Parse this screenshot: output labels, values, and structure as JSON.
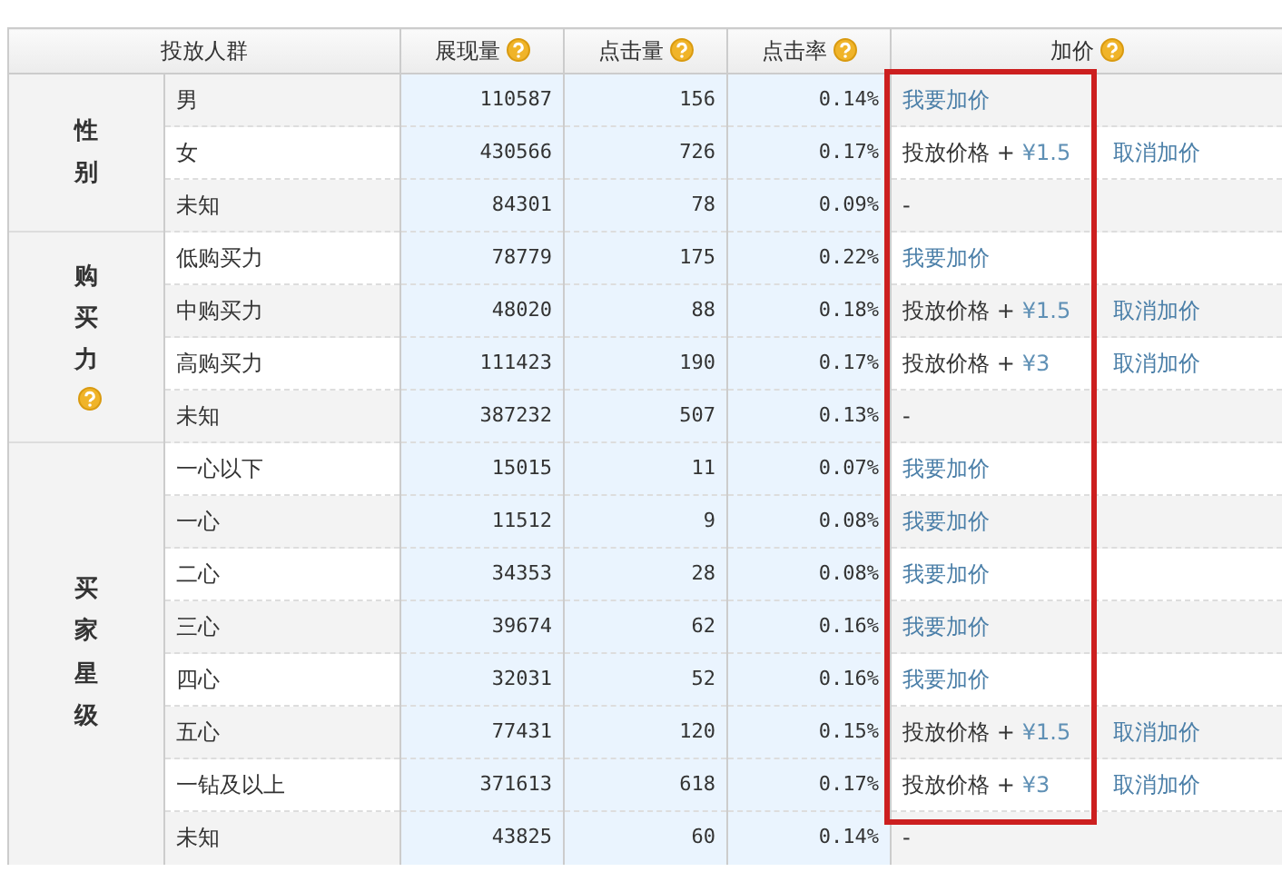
{
  "table": {
    "columns": [
      {
        "label": "投放人群",
        "help": false
      },
      {
        "label": "展现量",
        "help": true
      },
      {
        "label": "点击量",
        "help": true
      },
      {
        "label": "点击率",
        "help": true
      },
      {
        "label": "加价",
        "help": true
      }
    ],
    "groups": [
      {
        "label": "性别",
        "help": false,
        "rows": [
          {
            "name": "男",
            "impressions": "110587",
            "clicks": "156",
            "ctr": "0.14%",
            "bid": {
              "kind": "add",
              "link": "我要加价"
            }
          },
          {
            "name": "女",
            "impressions": "430566",
            "clicks": "726",
            "ctr": "0.17%",
            "bid": {
              "kind": "price",
              "label": "投放价格",
              "op": "+",
              "amount": "¥1.5",
              "cancel": "取消加价"
            }
          },
          {
            "name": "未知",
            "impressions": "84301",
            "clicks": "78",
            "ctr": "0.09%",
            "bid": {
              "kind": "none",
              "text": "-"
            }
          }
        ]
      },
      {
        "label": "购买力",
        "help": true,
        "rows": [
          {
            "name": "低购买力",
            "impressions": "78779",
            "clicks": "175",
            "ctr": "0.22%",
            "bid": {
              "kind": "add",
              "link": "我要加价"
            }
          },
          {
            "name": "中购买力",
            "impressions": "48020",
            "clicks": "88",
            "ctr": "0.18%",
            "bid": {
              "kind": "price",
              "label": "投放价格",
              "op": "+",
              "amount": "¥1.5",
              "cancel": "取消加价"
            }
          },
          {
            "name": "高购买力",
            "impressions": "111423",
            "clicks": "190",
            "ctr": "0.17%",
            "bid": {
              "kind": "price",
              "label": "投放价格",
              "op": "+",
              "amount": "¥3",
              "cancel": "取消加价"
            }
          },
          {
            "name": "未知",
            "impressions": "387232",
            "clicks": "507",
            "ctr": "0.13%",
            "bid": {
              "kind": "none",
              "text": "-"
            }
          }
        ]
      },
      {
        "label": "买家星级",
        "help": false,
        "rows": [
          {
            "name": "一心以下",
            "impressions": "15015",
            "clicks": "11",
            "ctr": "0.07%",
            "bid": {
              "kind": "add",
              "link": "我要加价"
            }
          },
          {
            "name": "一心",
            "impressions": "11512",
            "clicks": "9",
            "ctr": "0.08%",
            "bid": {
              "kind": "add",
              "link": "我要加价"
            }
          },
          {
            "name": "二心",
            "impressions": "34353",
            "clicks": "28",
            "ctr": "0.08%",
            "bid": {
              "kind": "add",
              "link": "我要加价"
            }
          },
          {
            "name": "三心",
            "impressions": "39674",
            "clicks": "62",
            "ctr": "0.16%",
            "bid": {
              "kind": "add",
              "link": "我要加价"
            }
          },
          {
            "name": "四心",
            "impressions": "32031",
            "clicks": "52",
            "ctr": "0.16%",
            "bid": {
              "kind": "add",
              "link": "我要加价"
            }
          },
          {
            "name": "五心",
            "impressions": "77431",
            "clicks": "120",
            "ctr": "0.15%",
            "bid": {
              "kind": "price",
              "label": "投放价格",
              "op": "+",
              "amount": "¥1.5",
              "cancel": "取消加价"
            }
          },
          {
            "name": "一钻及以上",
            "impressions": "371613",
            "clicks": "618",
            "ctr": "0.17%",
            "bid": {
              "kind": "price",
              "label": "投放价格",
              "op": "+",
              "amount": "¥3",
              "cancel": "取消加价"
            }
          },
          {
            "name": "未知",
            "impressions": "43825",
            "clicks": "60",
            "ctr": "0.14%",
            "bid": {
              "kind": "none",
              "text": "-"
            }
          }
        ]
      }
    ]
  }
}
